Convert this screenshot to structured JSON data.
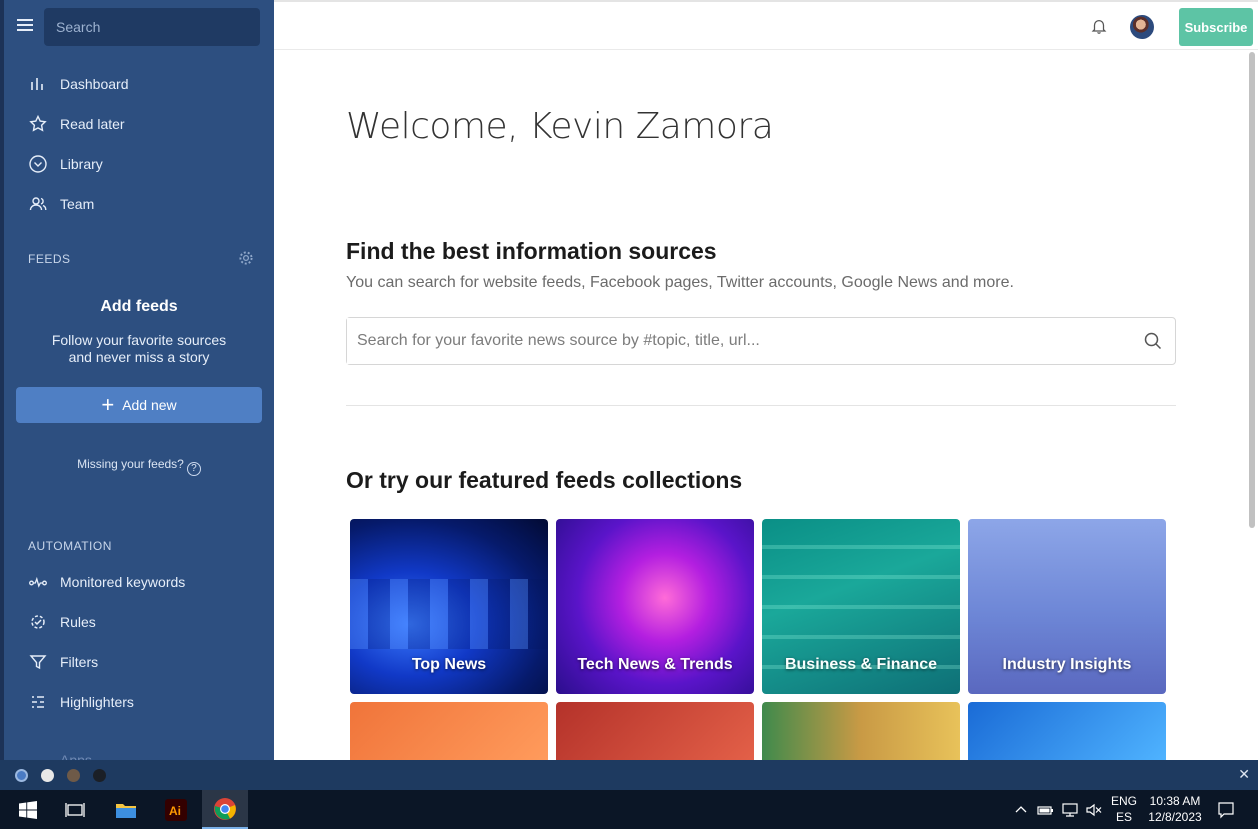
{
  "sidebar": {
    "search_placeholder": "Search",
    "nav": [
      {
        "label": "Dashboard",
        "icon": "bar-chart-icon"
      },
      {
        "label": "Read later",
        "icon": "star-icon"
      },
      {
        "label": "Library",
        "icon": "chevron-circle-icon"
      },
      {
        "label": "Team",
        "icon": "users-icon"
      }
    ],
    "feeds_label": "FEEDS",
    "add_feeds_title": "Add feeds",
    "add_feeds_line1": "Follow your favorite sources",
    "add_feeds_line2": "and never miss a story",
    "add_new_label": "Add new",
    "missing_feeds": "Missing your feeds?",
    "automation_label": "AUTOMATION",
    "automation": [
      {
        "label": "Monitored keywords",
        "icon": "pulse-icon"
      },
      {
        "label": "Rules",
        "icon": "rules-icon"
      },
      {
        "label": "Filters",
        "icon": "filter-icon"
      },
      {
        "label": "Highlighters",
        "icon": "highlighter-icon"
      }
    ],
    "apps_label": "Apps"
  },
  "topbar": {
    "subscribe_label": "Subscribe"
  },
  "main": {
    "welcome": "Welcome, Kevin Zamora",
    "find_title": "Find the best information sources",
    "find_sub": "You can search for website feeds, Facebook pages, Twitter accounts, Google News and more.",
    "search_placeholder": "Search for your favorite news source by #topic, title, url...",
    "featured_title": "Or try our featured feeds collections",
    "collections": [
      {
        "label": "Top News"
      },
      {
        "label": "Tech News & Trends"
      },
      {
        "label": "Business & Finance"
      },
      {
        "label": "Industry Insights"
      }
    ]
  },
  "bottom_bar": {
    "dot_colors": [
      "#4a7bc4",
      "#e8e8e8",
      "#6e5a48",
      "#1b1f26"
    ]
  },
  "taskbar": {
    "lang_top": "ENG",
    "lang_bottom": "ES",
    "time": "10:38 AM",
    "date": "12/8/2023"
  },
  "colors": {
    "sidebar": "#2d4f80",
    "accent_button": "#4f7fc4",
    "subscribe": "#5dc4a5"
  }
}
